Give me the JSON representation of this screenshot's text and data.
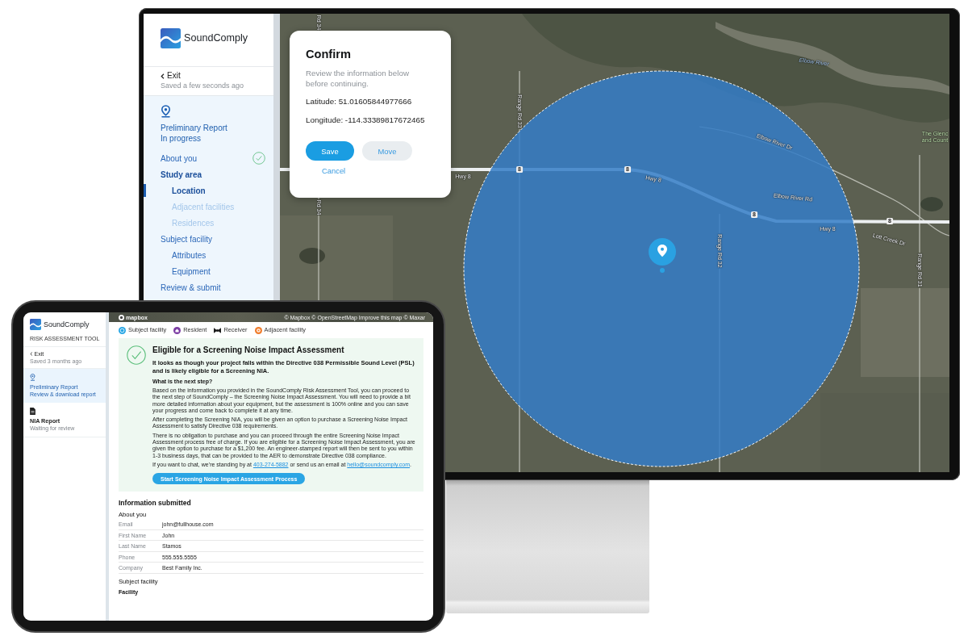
{
  "monitor": {
    "sidebar": {
      "brand": "SoundComply",
      "exit": "Exit",
      "saved": "Saved a few seconds ago",
      "report": {
        "title": "Preliminary Report",
        "status": "In progress"
      },
      "nav": [
        {
          "label": "About you",
          "completed": true
        },
        {
          "label": "Study area",
          "completed": false,
          "children": [
            {
              "label": "Location",
              "selected": true,
              "disabled": false
            },
            {
              "label": "Adjacent facilities",
              "selected": false,
              "disabled": true
            },
            {
              "label": "Residences",
              "selected": false,
              "disabled": true
            }
          ]
        },
        {
          "label": "Subject facility",
          "completed": false,
          "children": [
            {
              "label": "Attributes",
              "selected": false,
              "disabled": false
            },
            {
              "label": "Equipment",
              "selected": false,
              "disabled": false
            }
          ]
        },
        {
          "label": "Review & submit",
          "completed": false
        }
      ]
    },
    "map": {
      "labels": [
        {
          "text": "Rd 34",
          "kind": "road"
        },
        {
          "text": "Elbow River",
          "kind": "water"
        },
        {
          "text": "Range Rd 33",
          "kind": "road"
        },
        {
          "text": "The Glenc",
          "kind": "place"
        },
        {
          "text": "and Count",
          "kind": "place"
        },
        {
          "text": "Elbow River Dr",
          "kind": "road"
        },
        {
          "text": "Hwy 8",
          "kind": "road"
        },
        {
          "text": "8",
          "kind": "shield"
        },
        {
          "text": "8",
          "kind": "shield"
        },
        {
          "text": "Hwy 8",
          "kind": "road"
        },
        {
          "text": "Elbow River Rd",
          "kind": "road"
        },
        {
          "text": "Rd 34",
          "kind": "road"
        },
        {
          "text": "8",
          "kind": "shield"
        },
        {
          "text": "Hwy 8",
          "kind": "road"
        },
        {
          "text": "8",
          "kind": "shield"
        },
        {
          "text": "Lott Creek Dr",
          "kind": "road"
        },
        {
          "text": "Range Rd 32",
          "kind": "road"
        },
        {
          "text": "Range Rd 31",
          "kind": "road"
        }
      ]
    },
    "dialog": {
      "title": "Confirm",
      "message": "Review the information below before continuing.",
      "fields": [
        "Latitude: 51.01605844977666",
        "Longitude: -114.33389817672465"
      ],
      "buttons": [
        {
          "label": "Save",
          "kind": "primary"
        },
        {
          "label": "Move",
          "kind": "secondary"
        },
        {
          "label": "Cancel",
          "kind": "link"
        }
      ]
    }
  },
  "tablet": {
    "sidebar": {
      "brand": "SoundComply",
      "tagline": "RISK ASSESSMENT TOOL",
      "exit": "Exit",
      "saved": "Saved 3 months ago",
      "reports": [
        {
          "title": "Preliminary Report",
          "subtitle": "Review & download report",
          "selected": true
        },
        {
          "title": "NIA Report",
          "subtitle": "Waiting for review",
          "selected": false
        }
      ]
    },
    "map": {
      "logo": "mapbox",
      "attribution": "© Mapbox © OpenStreetMap Improve this map © Maxar"
    },
    "legend": [
      {
        "label": "Subject facility",
        "color": "#27a6e5"
      },
      {
        "label": "Resident",
        "color": "#7b3da3"
      },
      {
        "label": "Receiver",
        "color": "#1c1c1c"
      },
      {
        "label": "Adjacent facility",
        "color": "#f07c2c"
      }
    ],
    "result": {
      "title": "Eligible for a Screening Noise Impact Assessment",
      "lead": "It looks as though your project falls within the Directive 038 Permissible Sound Level (PSL) and is likely eligible for a Screening NIA.",
      "question": "What is the next step?",
      "paragraphs": [
        "Based on the information you provided in the SoundComply Risk Assessment Tool, you can proceed to the next step of SoundComply – the Screening Noise Impact Assessment. You will need to provide a bit more detailed information about your equipment, but the assessment is 100% online and you can save your progress and come back to complete it at any time.",
        "After completing the Screening NIA, you will be given an option to purchase a Screening Noise Impact Assessment to satisfy Directive 038 requirements.",
        "There is no obligation to purchase and you can proceed through the entire Screening Noise Impact Assessment process free of charge. If you are eligible for a Screening Noise Impact Assessment, you are given the option to purchase for a $1,200 fee. An engineer-stamped report will then be sent to you within 1-3 business days, that can be provided to the AER to demonstrate Directive 038 compliance."
      ],
      "contact": {
        "before": "If you want to chat, we’re standing by at",
        "phone": "403-274-5882",
        "middle": "or send us an email at",
        "email": "hello@soundcomply.com",
        "after": "."
      },
      "button": "Start Screening Noise Impact Assessment Process"
    },
    "submitted": {
      "title": "Information submitted",
      "sections": [
        {
          "title": "About you",
          "rows": [
            {
              "label": "Email",
              "value": "john@fullhouse.com"
            },
            {
              "label": "First Name",
              "value": "John"
            },
            {
              "label": "Last Name",
              "value": "Stamos"
            },
            {
              "label": "Phone",
              "value": "555.555.5555"
            },
            {
              "label": "Company",
              "value": "Best Family Inc."
            }
          ]
        },
        {
          "title": "Subject facility",
          "subheading": "Facility"
        }
      ]
    }
  }
}
